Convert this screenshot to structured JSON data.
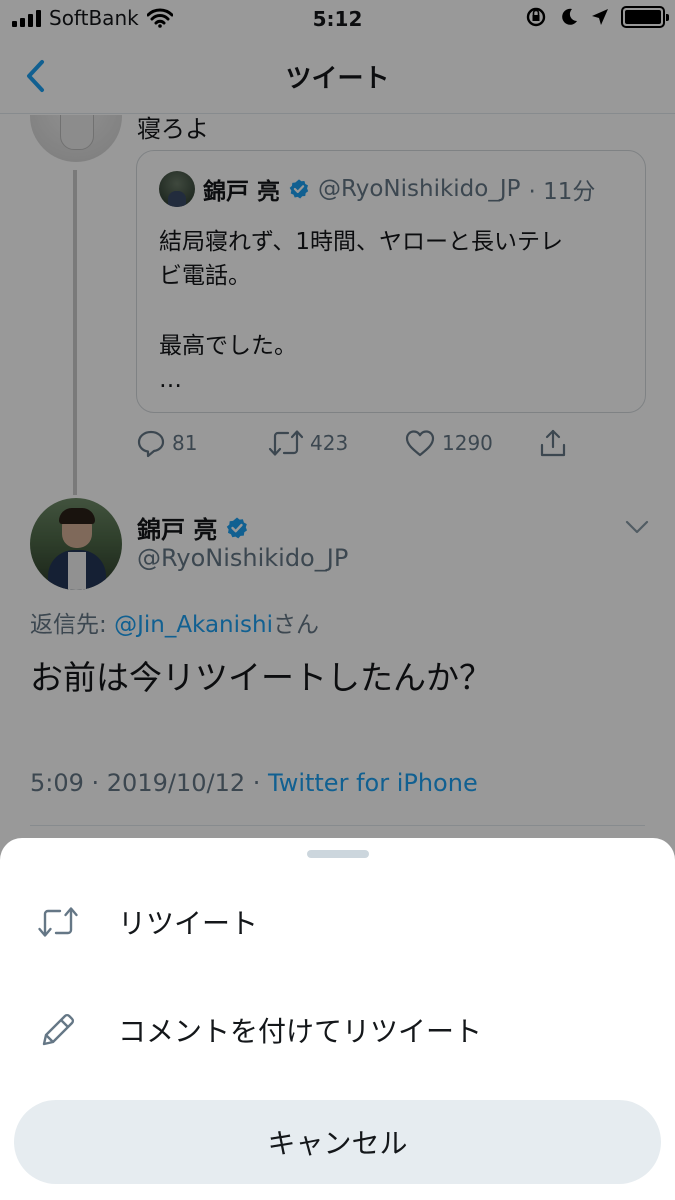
{
  "status_bar": {
    "carrier": "SoftBank",
    "time": "5:12"
  },
  "nav": {
    "title": "ツイート"
  },
  "previous_tweet": {
    "text_fragment": "寝ろよ"
  },
  "quoted_tweet": {
    "name": "錦戸 亮",
    "handle": "@RyoNishikido_JP",
    "time": "· 11分",
    "line1": "結局寝れず、1時間、ヤローと長いテレ",
    "line2": "ビ電話。",
    "line3": "最高でした。",
    "line4": "…"
  },
  "actions": {
    "replies": "81",
    "retweets": "423",
    "likes": "1290"
  },
  "main_tweet": {
    "name": "錦戸 亮",
    "handle": "@RyoNishikido_JP",
    "reply_prefix": "返信先: ",
    "reply_user": "@Jin_Akanishi",
    "reply_suffix": "さん",
    "text": "お前は今リツイートしたんか？",
    "timestamp": "5:09 · 2019/10/12 · ",
    "source": "Twitter for iPhone"
  },
  "sheet": {
    "retweet_label": "リツイート",
    "quote_label": "コメントを付けてリツイート",
    "cancel_label": "キャンセル"
  },
  "colors": {
    "accent": "#1da1f2",
    "secondary_text": "#657786",
    "cancel_bg": "#e6ecf0"
  },
  "icons": {
    "back": "chevron-left-icon",
    "retweet": "retweet-icon",
    "quote": "pencil-icon",
    "reply": "reply-icon",
    "like": "heart-icon",
    "share": "share-icon",
    "verified": "verified-badge-icon"
  }
}
